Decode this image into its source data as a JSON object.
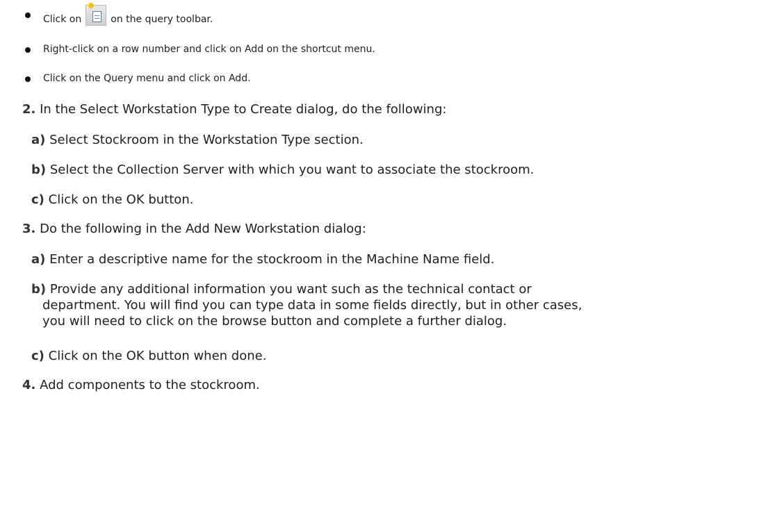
{
  "bullets": [
    {
      "before": "Click on",
      "after": "on the query toolbar."
    },
    {
      "text": "Right-click on a row number and click on Add on the shortcut menu."
    },
    {
      "text": "Click on the Query menu and click on Add."
    }
  ],
  "toolbar_icon": "add-new-icon",
  "steps": [
    {
      "num": "2.",
      "text": "In the Select Workstation Type to Create dialog, do the following:",
      "subs": [
        {
          "label": "a)",
          "text": "Select Stockroom in the Workstation Type section."
        },
        {
          "label": "b)",
          "text": "Select the Collection Server with which you want to associate the stockroom."
        },
        {
          "label": "c)",
          "text": "Click on the OK button."
        }
      ]
    },
    {
      "num": "3.",
      "text": "Do the following in the Add New Workstation dialog:",
      "subs": [
        {
          "label": "a)",
          "text": "Enter a descriptive name for the stockroom in the Machine Name field."
        },
        {
          "label": "b)",
          "line1": "Provide any additional information you want such as the technical contact or",
          "line2": "department. You will find you can type data in some fields directly, but in other cases,",
          "line3": "you will need to click on the browse button and complete a further dialog."
        },
        {
          "label": "c)",
          "text": "Click on the OK button when done."
        }
      ]
    },
    {
      "num": "4.",
      "text": "Add components to the stockroom."
    }
  ]
}
